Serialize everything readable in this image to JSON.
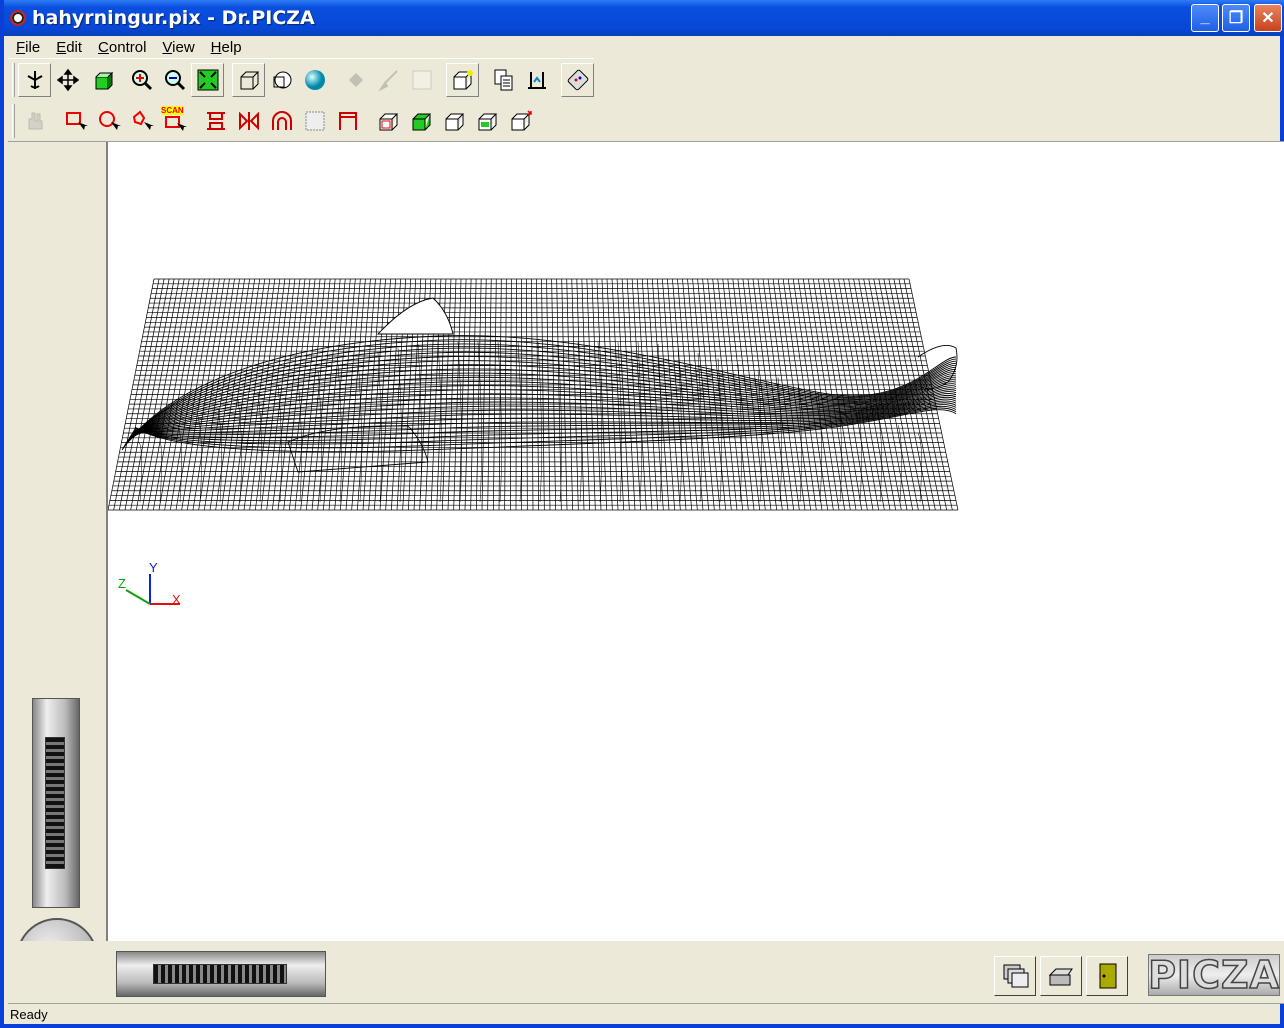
{
  "window": {
    "title": "hahyrningur.pix - Dr.PICZA"
  },
  "title_buttons": {
    "minimize": "_",
    "maximize": "❐",
    "close": "✕"
  },
  "menu": [
    "File",
    "Edit",
    "Control",
    "View",
    "Help"
  ],
  "toolbar1": [
    {
      "name": "rotate-tool-icon"
    },
    {
      "name": "move-tool-icon"
    },
    {
      "name": "cube-view-icon"
    },
    {
      "name": "zoom-in-icon"
    },
    {
      "name": "zoom-out-icon"
    },
    {
      "name": "fit-view-icon"
    },
    {
      "name": "wireframe-icon"
    },
    {
      "name": "shaded-wire-icon"
    },
    {
      "name": "sphere-render-icon"
    },
    {
      "name": "paint-bucket-icon"
    },
    {
      "name": "brush-icon"
    },
    {
      "name": "blank-tool-icon"
    },
    {
      "name": "box-edit-icon"
    },
    {
      "name": "copy-document-icon"
    },
    {
      "name": "scan-settings-icon"
    },
    {
      "name": "remote-control-icon"
    }
  ],
  "toolbar2": [
    {
      "name": "hand-tool-icon"
    },
    {
      "name": "select-rect-icon"
    },
    {
      "name": "select-circle-icon"
    },
    {
      "name": "select-free-icon"
    },
    {
      "name": "scan-area-icon"
    },
    {
      "name": "mirror-vertical-icon"
    },
    {
      "name": "mirror-horizontal-icon"
    },
    {
      "name": "arch-icon"
    },
    {
      "name": "grid-frame-icon"
    },
    {
      "name": "frame-corner-icon"
    },
    {
      "name": "box-red-icon"
    },
    {
      "name": "box-green-icon"
    },
    {
      "name": "box-plain-icon"
    },
    {
      "name": "box-layer-icon"
    },
    {
      "name": "box-arrow-icon"
    }
  ],
  "scan_label": "SCAN",
  "axes": {
    "x": "X",
    "y": "Y",
    "z": "Z",
    "x_color": "#e01010",
    "y_color": "#1020e0",
    "z_color": "#10a010"
  },
  "logo": "PICZA",
  "status": "Ready"
}
